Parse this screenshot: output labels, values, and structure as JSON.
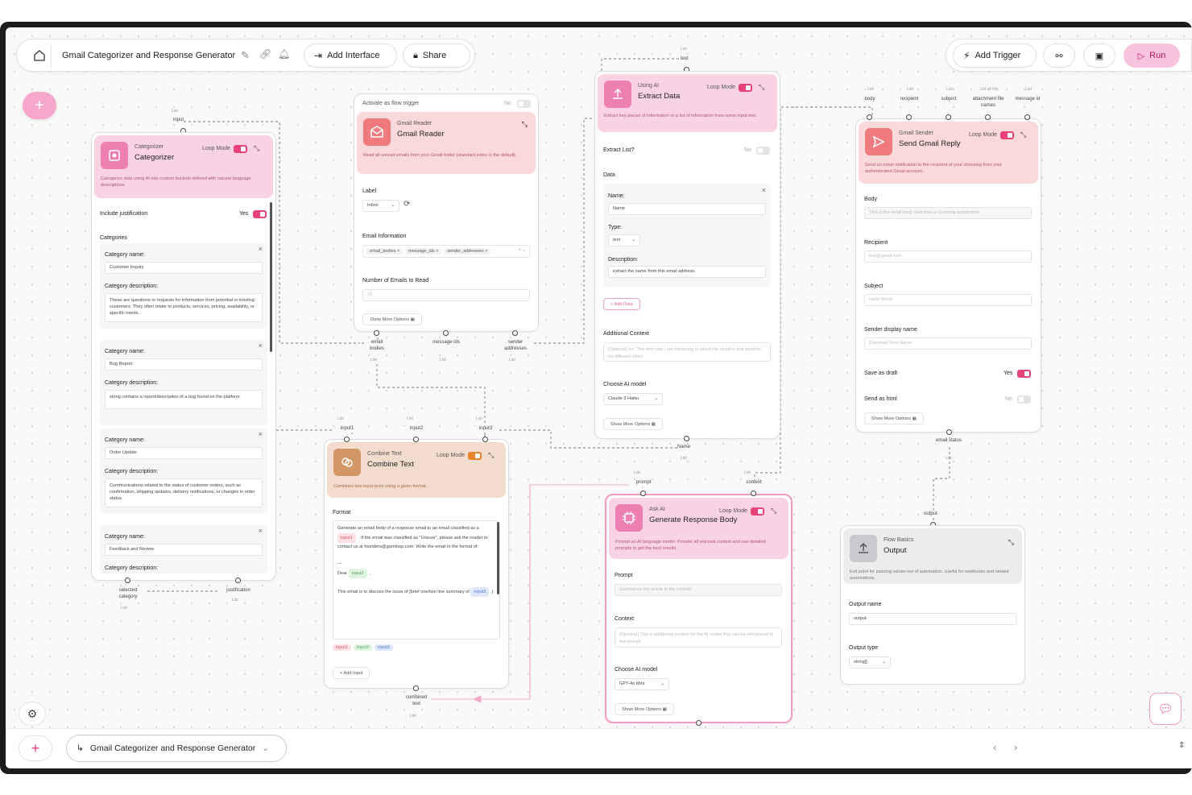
{
  "toolbar": {
    "title": "Gmail Categorizer and Response Generator",
    "add_interface": "Add Interface",
    "share": "Share",
    "add_trigger": "Add Trigger",
    "run": "Run"
  },
  "bottombar": {
    "flow_name": "Gmail Categorizer and Response Generator"
  },
  "common": {
    "list": "List",
    "loop_mode": "Loop Mode",
    "show_more": "Show More Options",
    "choose_model": "Choose AI model",
    "yes": "Yes",
    "no": "No"
  },
  "categorizer": {
    "sub": "Categorizer",
    "title": "Categorizer",
    "desc": "Categorize data using AI into custom buckets defined with natural language descriptions",
    "include_just": "Include justification",
    "include_val": "Yes",
    "categories_label": "Categories",
    "cat_name_label": "Category name:",
    "cat_desc_label": "Category description:",
    "items": [
      {
        "name": "Customer Inquiry",
        "desc": "These are questions or requests for information from potential or existing customers. They often relate to products, services, pricing, availability, or specific needs."
      },
      {
        "name": "Bug Report",
        "desc": "string contains a report/description of a bug found on the platform"
      },
      {
        "name": "Order Update",
        "desc": "Communications related to the status of customer orders, such as confirmation, shipping updates, delivery notifications, or changes in order status."
      },
      {
        "name": "Feedback and Review",
        "desc": ""
      }
    ],
    "in_port": "input",
    "out1": "selected category",
    "out2": "justification"
  },
  "gmail_reader": {
    "trigger": "Activate as flow trigger",
    "trigger_val": "No",
    "sub": "Gmail Reader",
    "title": "Gmail Reader",
    "desc": "Read all unread emails from your Gmail folder (standard inbox is the default).",
    "label_label": "Label",
    "label_val": "Inbox",
    "email_info": "Email Information",
    "tags": [
      "email_bodies",
      "message_ids",
      "sender_addresses"
    ],
    "num_label": "Number of Emails to Read",
    "num_ph": "10",
    "out1": "email bodies",
    "out2": "message ids",
    "out3": "sender addresses"
  },
  "extract": {
    "in_port": "text",
    "sub": "Using AI",
    "title": "Extract Data",
    "desc": "Extract key pieces of information or a list of information from some input text.",
    "extract_list": "Extract List?",
    "extract_val": "No",
    "data_label": "Data",
    "name_label": "Name:",
    "name_val": "Name",
    "type_label": "Type:",
    "type_val": "text",
    "desc_label": "Description:",
    "desc_val": "extract the name from this email address.",
    "add_data": "Add Data",
    "add_ctx": "Additional Context",
    "add_ctx_ph": "[Optional] ex: 'The item that I am extracting is about the location and weather for different cities'",
    "model": "Claude 3 Haiku",
    "out": "Name"
  },
  "sender": {
    "ports": [
      "body",
      "recipient",
      "subject",
      "attachment file names",
      "message id"
    ],
    "port_types": [
      "List",
      "List",
      "List",
      "List of File",
      "List"
    ],
    "sub": "Gmail Sender",
    "title": "Send Gmail Reply",
    "desc": "Send an email notification to the recipient of your choosing from your authenticated Gmail account.",
    "body_label": "Body",
    "body_ph": "This is the email body sent from a Gumloop automation",
    "recipient_label": "Recipient",
    "recipient_ph": "test@gmail.com",
    "subject_label": "Subject",
    "subject_ph": "Hello World",
    "display_label": "Sender display name",
    "display_ph": "[Optional] Your Name",
    "draft_label": "Save as draft",
    "draft_val": "Yes",
    "html_label": "Send as html",
    "html_val": "No",
    "out": "email status"
  },
  "combine": {
    "ports": [
      "input1",
      "input2",
      "input3"
    ],
    "sub": "Combine Text",
    "title": "Combine Text",
    "desc": "Combines two input texts using a given format.",
    "format_label": "Format",
    "format_p1": "Generate an email body of a response email to an email classified as a",
    "format_c1": "input1",
    "format_p2": ". If the email was classified as \"Unsure\", please ask the reader to contact us at founders@gumloop.com. Write the email in the format of:",
    "format_dash": "---",
    "format_dear": "Dear",
    "format_c2": "input2",
    "format_p3": "This email is to discuss the issue of [brief one/two line summary of",
    "format_c3": "input3",
    "chips": [
      "input1",
      "input2",
      "input3"
    ],
    "add_input": "Add Input",
    "out": "combined text"
  },
  "askai": {
    "ports": [
      "prompt",
      "context"
    ],
    "sub": "Ask AI",
    "title": "Generate Response Body",
    "desc": "Prompt an AI language model. Provide all relevant context and use detailed prompts to get the best results",
    "prompt_label": "Prompt",
    "prompt_ph": "Summarize the article in the context",
    "context_label": "Context",
    "context_ph": "[Optional] This is additional context for the AI model that can be referenced in the prompt",
    "model": "GPT-4o Mini"
  },
  "output": {
    "in_port": "output",
    "sub": "Flow Basics",
    "title": "Output",
    "desc": "Exit point for passing values out of automation. Useful for webhooks and nested automations.",
    "name_label": "Output name",
    "name_val": "output",
    "type_label": "Output type",
    "type_val": "string[]"
  },
  "colors": {
    "accent": "#e8427a",
    "run_bg": "#f8c3dc"
  }
}
